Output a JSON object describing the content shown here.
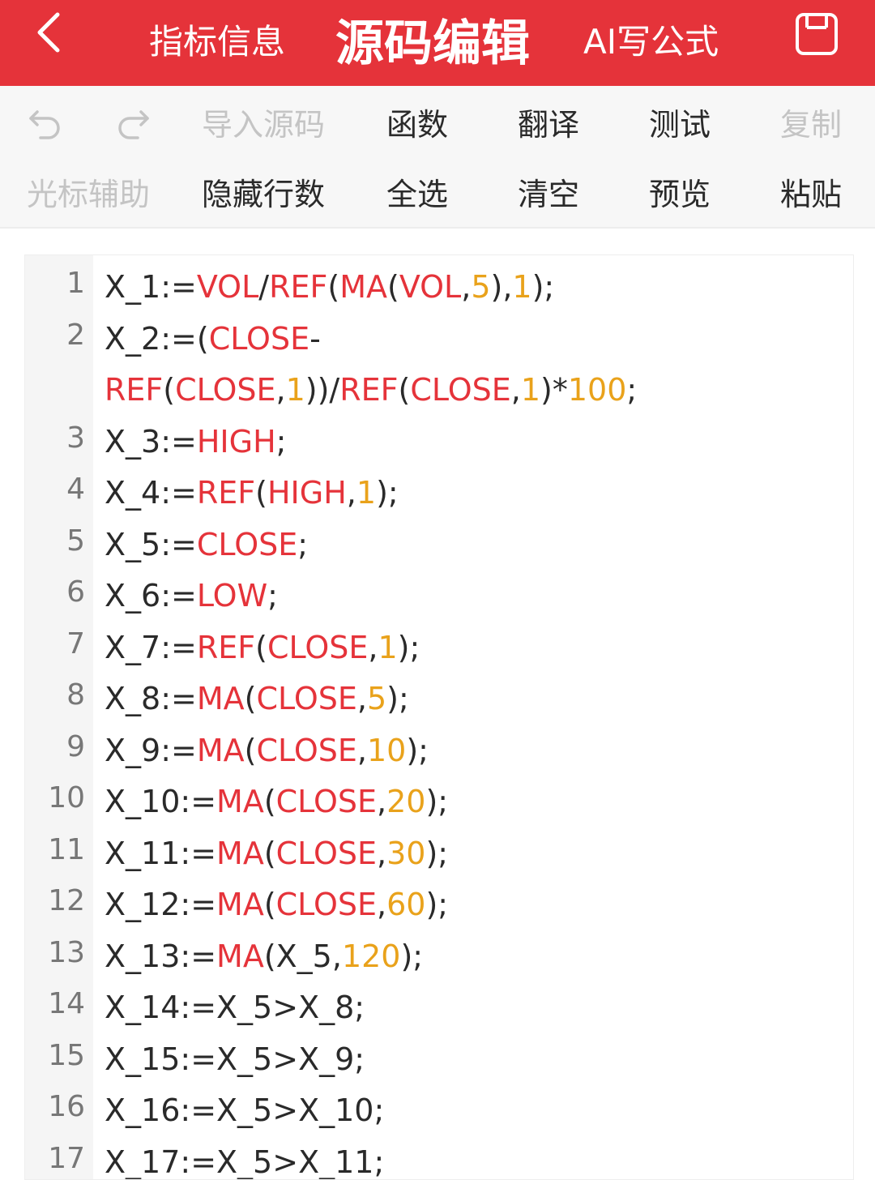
{
  "header": {
    "tabs": {
      "info": "指标信息",
      "source": "源码编辑",
      "ai": "AI写公式"
    },
    "colors": {
      "bar": "#e5333a",
      "text": "#ffffff"
    },
    "icons": {
      "back": "chevron-left-icon",
      "save": "save-icon"
    }
  },
  "toolbar": {
    "undo_icon": "undo-icon",
    "redo_icon": "redo-icon",
    "import": "导入源码",
    "functions": "函数",
    "translate": "翻译",
    "test": "测试",
    "copy": "复制",
    "cursor_assist": "光标辅助",
    "hide_line_numbers": "隐藏行数",
    "select_all": "全选",
    "clear": "清空",
    "preview": "预览",
    "paste": "粘贴"
  },
  "editor": {
    "colors": {
      "keyword": "#e5333a",
      "number": "#e9a21b",
      "text": "#2a2a2a",
      "line_number": "#777777"
    },
    "lines": [
      {
        "n": "1",
        "tokens": [
          [
            "X_1:=",
            ""
          ],
          [
            "VOL",
            "kw"
          ],
          [
            "/",
            ""
          ],
          [
            "REF",
            "kw"
          ],
          [
            "(",
            ""
          ],
          [
            "MA",
            "kw"
          ],
          [
            "(",
            ""
          ],
          [
            "VOL",
            "kw"
          ],
          [
            ",",
            ""
          ],
          [
            "5",
            "num"
          ],
          [
            "),",
            ""
          ],
          [
            "1",
            "num"
          ],
          [
            ");",
            ""
          ]
        ]
      },
      {
        "n": "2",
        "tokens": [
          [
            "X_2:=(",
            ""
          ],
          [
            "CLOSE",
            "kw"
          ],
          [
            "- ",
            ""
          ],
          [
            "REF",
            "kw"
          ],
          [
            "(",
            ""
          ],
          [
            "CLOSE",
            "kw"
          ],
          [
            ",",
            ""
          ],
          [
            "1",
            "num"
          ],
          [
            "))/",
            ""
          ],
          [
            "REF",
            "kw"
          ],
          [
            "(",
            ""
          ],
          [
            "CLOSE",
            "kw"
          ],
          [
            ",",
            ""
          ],
          [
            "1",
            "num"
          ],
          [
            ")*",
            ""
          ],
          [
            "100",
            "num"
          ],
          [
            ";",
            ""
          ]
        ]
      },
      {
        "n": "3",
        "tokens": [
          [
            "X_3:=",
            ""
          ],
          [
            "HIGH",
            "kw"
          ],
          [
            ";",
            ""
          ]
        ]
      },
      {
        "n": "4",
        "tokens": [
          [
            "X_4:=",
            ""
          ],
          [
            "REF",
            "kw"
          ],
          [
            "(",
            ""
          ],
          [
            "HIGH",
            "kw"
          ],
          [
            ",",
            ""
          ],
          [
            "1",
            "num"
          ],
          [
            ");",
            ""
          ]
        ]
      },
      {
        "n": "5",
        "tokens": [
          [
            "X_5:=",
            ""
          ],
          [
            "CLOSE",
            "kw"
          ],
          [
            ";",
            ""
          ]
        ]
      },
      {
        "n": "6",
        "tokens": [
          [
            "X_6:=",
            ""
          ],
          [
            "LOW",
            "kw"
          ],
          [
            ";",
            ""
          ]
        ]
      },
      {
        "n": "7",
        "tokens": [
          [
            "X_7:=",
            ""
          ],
          [
            "REF",
            "kw"
          ],
          [
            "(",
            ""
          ],
          [
            "CLOSE",
            "kw"
          ],
          [
            ",",
            ""
          ],
          [
            "1",
            "num"
          ],
          [
            ");",
            ""
          ]
        ]
      },
      {
        "n": "8",
        "tokens": [
          [
            "X_8:=",
            ""
          ],
          [
            "MA",
            "kw"
          ],
          [
            "(",
            ""
          ],
          [
            "CLOSE",
            "kw"
          ],
          [
            ",",
            ""
          ],
          [
            "5",
            "num"
          ],
          [
            ");",
            ""
          ]
        ]
      },
      {
        "n": "9",
        "tokens": [
          [
            "X_9:=",
            ""
          ],
          [
            "MA",
            "kw"
          ],
          [
            "(",
            ""
          ],
          [
            "CLOSE",
            "kw"
          ],
          [
            ",",
            ""
          ],
          [
            "10",
            "num"
          ],
          [
            ");",
            ""
          ]
        ]
      },
      {
        "n": "10",
        "tokens": [
          [
            "X_10:=",
            ""
          ],
          [
            "MA",
            "kw"
          ],
          [
            "(",
            ""
          ],
          [
            "CLOSE",
            "kw"
          ],
          [
            ",",
            ""
          ],
          [
            "20",
            "num"
          ],
          [
            ");",
            ""
          ]
        ]
      },
      {
        "n": "11",
        "tokens": [
          [
            "X_11:=",
            ""
          ],
          [
            "MA",
            "kw"
          ],
          [
            "(",
            ""
          ],
          [
            "CLOSE",
            "kw"
          ],
          [
            ",",
            ""
          ],
          [
            "30",
            "num"
          ],
          [
            ");",
            ""
          ]
        ]
      },
      {
        "n": "12",
        "tokens": [
          [
            "X_12:=",
            ""
          ],
          [
            "MA",
            "kw"
          ],
          [
            "(",
            ""
          ],
          [
            "CLOSE",
            "kw"
          ],
          [
            ",",
            ""
          ],
          [
            "60",
            "num"
          ],
          [
            ");",
            ""
          ]
        ]
      },
      {
        "n": "13",
        "tokens": [
          [
            "X_13:=",
            ""
          ],
          [
            "MA",
            "kw"
          ],
          [
            "(X_5,",
            ""
          ],
          [
            "120",
            "num"
          ],
          [
            ");",
            ""
          ]
        ]
      },
      {
        "n": "14",
        "tokens": [
          [
            "X_14:=X_5>X_8;",
            ""
          ]
        ]
      },
      {
        "n": "15",
        "tokens": [
          [
            "X_15:=X_5>X_9;",
            ""
          ]
        ]
      },
      {
        "n": "16",
        "tokens": [
          [
            "X_16:=X_5>X_10;",
            ""
          ]
        ]
      },
      {
        "n": "17",
        "tokens": [
          [
            "X_17:=X_5>X_11;",
            ""
          ]
        ]
      }
    ]
  }
}
